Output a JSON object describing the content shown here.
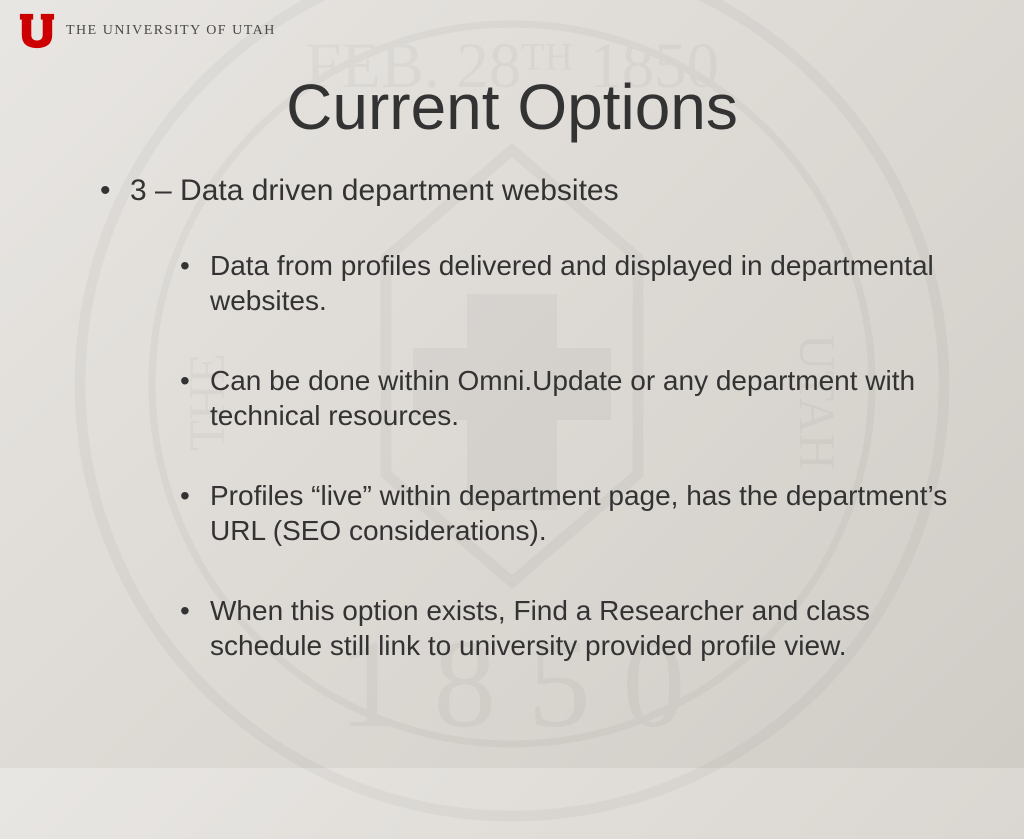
{
  "header": {
    "university_name": "THE UNIVERSITY OF UTAH"
  },
  "slide": {
    "title": "Current Options",
    "main_point": "3 – Data driven department websites",
    "sub_points": [
      "Data from profiles delivered and displayed in departmental websites.",
      "Can be done within Omni.Update or any department with technical resources.",
      "Profiles “live” within department page, has the department’s URL (SEO considerations).",
      "When this option exists, Find a Researcher and class schedule still link to university provided profile view."
    ]
  }
}
